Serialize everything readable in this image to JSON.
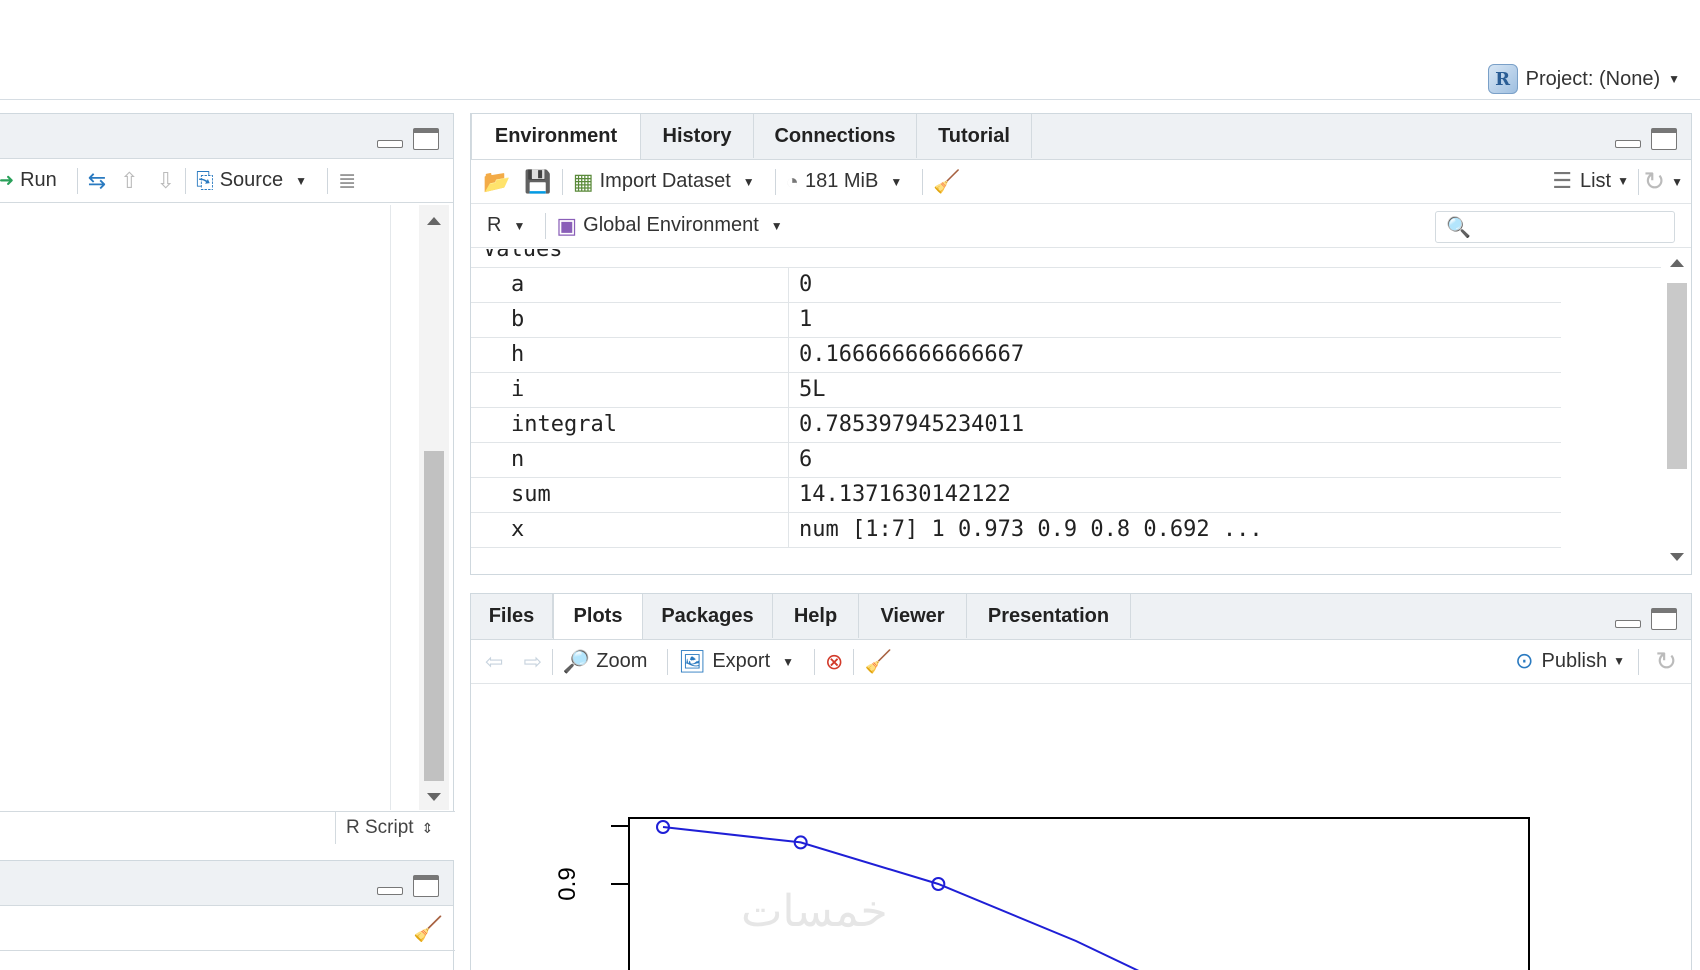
{
  "topbar": {
    "project_label": "Project: (None)"
  },
  "source_pane": {
    "toolbar": {
      "run_label": "Run",
      "source_label": "Source"
    },
    "footer": {
      "filetype": "R Script"
    }
  },
  "env_pane": {
    "tabs": [
      {
        "label": "Environment",
        "active": true
      },
      {
        "label": "History",
        "active": false
      },
      {
        "label": "Connections",
        "active": false
      },
      {
        "label": "Tutorial",
        "active": false
      }
    ],
    "toolbar": {
      "import_label": "Import Dataset",
      "memory_label": "181 MiB",
      "view_label": "List"
    },
    "scope": {
      "language": "R",
      "environment": "Global Environment"
    },
    "search": {
      "placeholder": ""
    },
    "section_label": "Values",
    "variables": [
      {
        "name": "a",
        "value": "0"
      },
      {
        "name": "b",
        "value": "1"
      },
      {
        "name": "h",
        "value": "0.166666666666667"
      },
      {
        "name": "i",
        "value": "5L"
      },
      {
        "name": "integral",
        "value": "0.785397945234011"
      },
      {
        "name": "n",
        "value": "6"
      },
      {
        "name": "sum",
        "value": "14.1371630142122"
      },
      {
        "name": "x",
        "value": "num [1:7] 1 0.973 0.9 0.8 0.692 ..."
      }
    ]
  },
  "files_pane": {
    "tabs": [
      {
        "label": "Files",
        "active": false
      },
      {
        "label": "Plots",
        "active": true
      },
      {
        "label": "Packages",
        "active": false
      },
      {
        "label": "Help",
        "active": false
      },
      {
        "label": "Viewer",
        "active": false
      },
      {
        "label": "Presentation",
        "active": false
      }
    ],
    "toolbar": {
      "zoom_label": "Zoom",
      "export_label": "Export",
      "publish_label": "Publish"
    }
  },
  "chart_data": {
    "type": "line",
    "x": [
      0,
      0.1666667,
      0.3333333,
      0.5
    ],
    "y": [
      1,
      0.972973,
      0.9,
      0.8
    ],
    "ytick_labels": [
      "0.9"
    ],
    "series_color": "#1f1fd6",
    "marker": "open-circle"
  },
  "watermark": "خمسات"
}
